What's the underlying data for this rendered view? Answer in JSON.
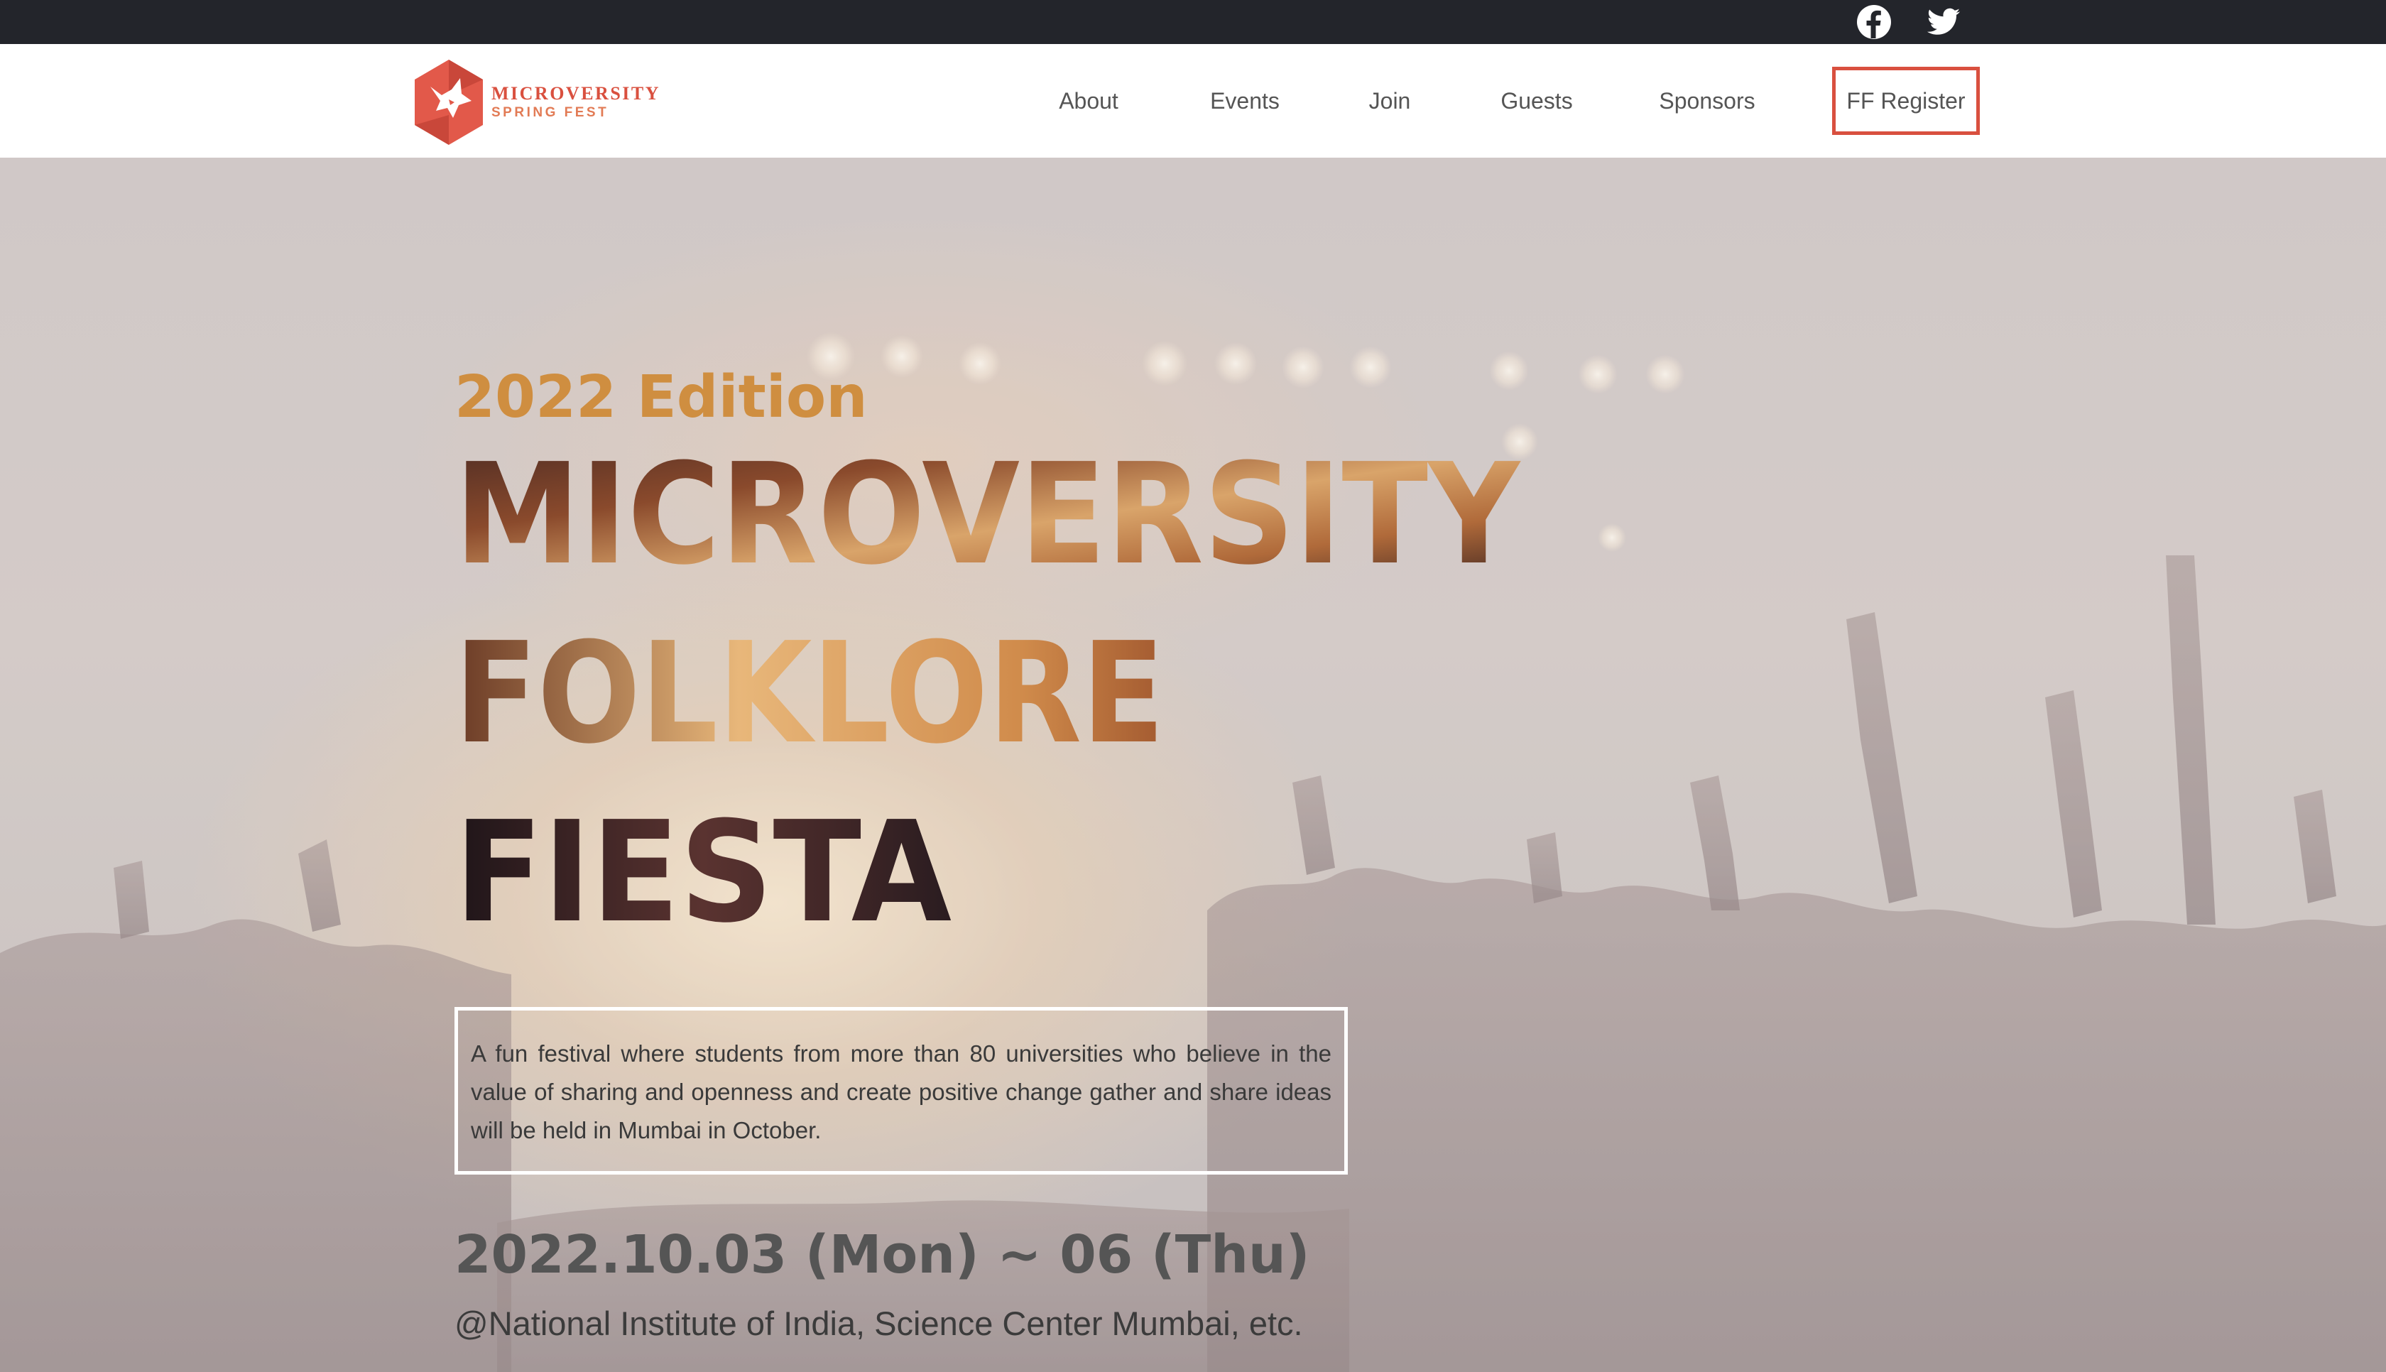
{
  "social": {
    "icons": [
      "facebook-icon",
      "twitter-icon"
    ]
  },
  "header": {
    "logo": {
      "line1": "MICROVERSITY",
      "line2": "SPRING FEST"
    },
    "nav": [
      {
        "label": "About"
      },
      {
        "label": "Events"
      },
      {
        "label": "Join"
      },
      {
        "label": "Guests"
      },
      {
        "label": "Sponsors"
      }
    ],
    "register_label": "FF Register"
  },
  "hero": {
    "edition": "2022 Edition",
    "title_lines": [
      "MICROVERSITY",
      "FOLKLORE",
      "FIESTA"
    ],
    "description": "A fun festival where students from more than 80 universities who believe in the value of sharing and openness and create positive change gather and share ideas will be held in Mumbai in October.",
    "date": "2022.10.03 (Mon) ~ 06 (Thu)",
    "venue": "@National Institute of India, Science Center Mumbai, etc."
  },
  "colors": {
    "accent": "#d9503f",
    "edition_gold": "#cf8e40",
    "topbar": "#23252b"
  }
}
